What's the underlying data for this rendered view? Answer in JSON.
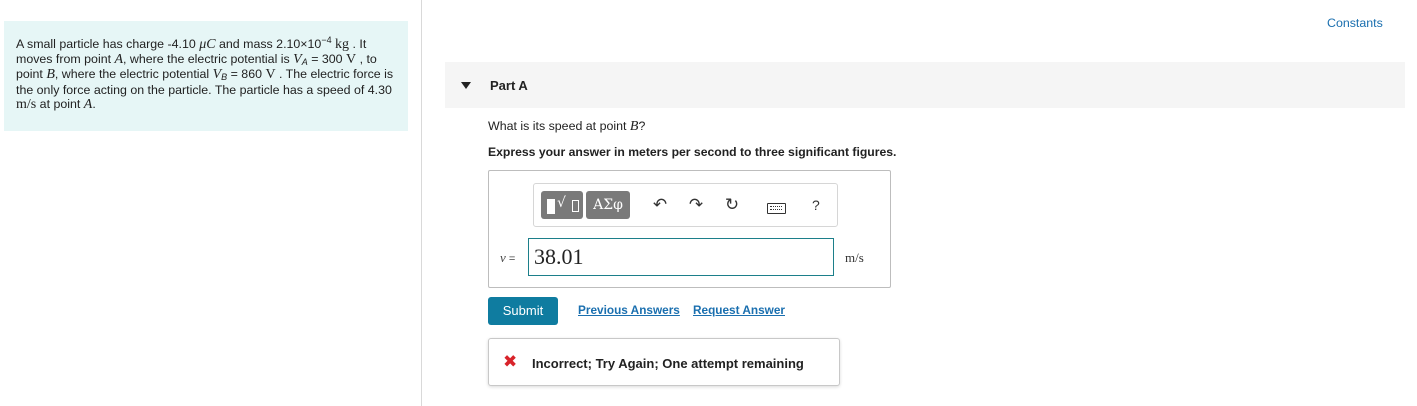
{
  "problem": {
    "t1": "A small particle has charge -4.10 ",
    "charge_unit": "μC",
    "t2": " and mass 2.10×10",
    "mass_exp": "−4",
    "t3": " ",
    "mass_unit": "kg",
    "t4": " . It moves from point ",
    "point_a": "A",
    "t5": ", where the electric potential is ",
    "va_symbol": "V",
    "va_sub": "A",
    "t6": " = 300 ",
    "volt_unit_1": "V",
    "t7": " , to point ",
    "point_b": "B",
    "t8": ", where the electric potential ",
    "vb_symbol": "V",
    "vb_sub": "B",
    "t9": " = 860 ",
    "volt_unit_2": "V",
    "t10": " . The electric force is the only force acting on the particle. The particle has a speed of 4.30 ",
    "speed_unit": "m/s",
    "t11": " at point ",
    "point_a_2": "A",
    "t12": "."
  },
  "header": {
    "constants_label": "Constants"
  },
  "part": {
    "title": "Part A",
    "question_text": "What is its speed at point ",
    "question_point": "B",
    "question_end": "?",
    "instruction": "Express your answer in meters per second to three significant figures."
  },
  "toolbar": {
    "templates_radical": "√",
    "greek_label": "ΑΣφ",
    "undo_glyph": "↶",
    "redo_glyph": "↷",
    "reset_glyph": "↻",
    "help_label": "?"
  },
  "answer": {
    "variable": "v",
    "equals": " =",
    "value": "38.01",
    "units": "m/s"
  },
  "actions": {
    "submit_label": "Submit",
    "previous_answers_label": "Previous Answers",
    "request_answer_label": "Request Answer"
  },
  "feedback": {
    "icon": "✖",
    "message": "Incorrect; Try Again; One attempt remaining"
  },
  "colors": {
    "accent": "#0f7ca0",
    "link": "#1a6faf",
    "problem_bg": "#e6f6f6",
    "error": "#d8232a"
  },
  "icons": [
    "templates-icon",
    "greek-icon",
    "undo-icon",
    "redo-icon",
    "reset-icon",
    "keyboard-icon",
    "help-icon",
    "incorrect-x-icon",
    "collapse-caret-icon"
  ]
}
